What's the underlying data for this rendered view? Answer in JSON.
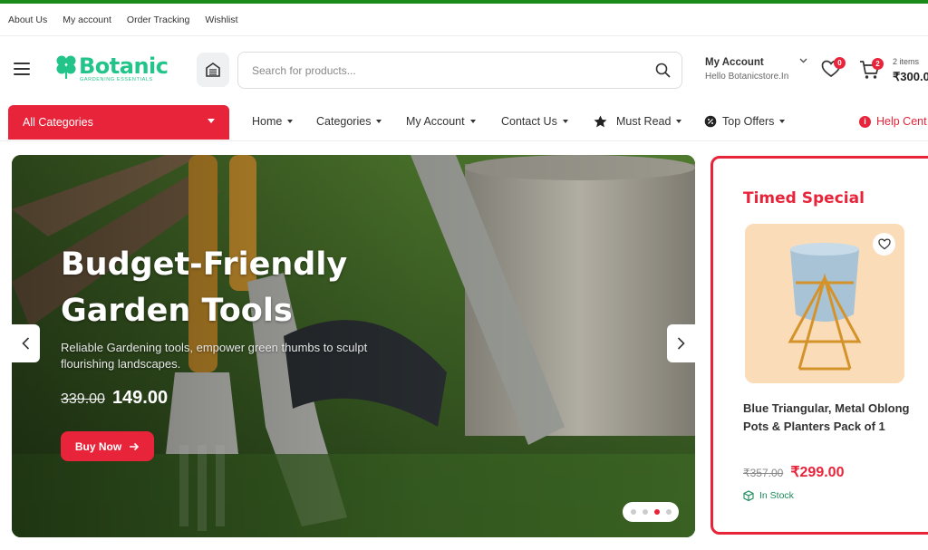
{
  "topbar": {
    "links": [
      "About Us",
      "My account",
      "Order Tracking",
      "Wishlist"
    ]
  },
  "header": {
    "logo_text": "Botanic",
    "logo_tagline": "GARDENING ESSENTIALS",
    "search_placeholder": "Search for products...",
    "account_label": "My Account",
    "account_greeting": "Hello Botanicstore.In",
    "wishlist_count": "0",
    "cart_count": "2",
    "cart_items": "2 items",
    "cart_total": "₹300.0"
  },
  "nav": {
    "all_categories": "All Categories",
    "items": [
      "Home",
      "Categories",
      "My Account",
      "Contact Us",
      "Must Read",
      "Top Offers"
    ],
    "help": "Help Cent"
  },
  "hero": {
    "title_line1": "Budget-Friendly",
    "title_line2": "Garden Tools",
    "subtitle": "Reliable Gardening tools, empower green thumbs to sculpt flourishing landscapes.",
    "old_price": "339.00",
    "new_price": "149.00",
    "cta": "Buy Now",
    "slides": 4,
    "active_slide": 3
  },
  "timed_special": {
    "title": "Timed Special",
    "product_name": "Blue Triangular, Metal Oblong Pots & Planters Pack of 1",
    "old_price": "₹357.00",
    "new_price": "₹299.00",
    "stock": "In Stock"
  },
  "colors": {
    "accent": "#e8243a",
    "brand": "#22c48a",
    "topline": "#1a8a1a"
  }
}
